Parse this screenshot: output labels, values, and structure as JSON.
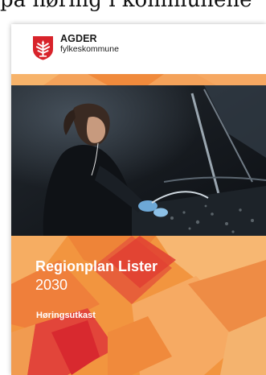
{
  "page_heading": "på høring i kommunene",
  "publisher": {
    "name": "AGDER",
    "subtitle": "fylkeskommune",
    "logo_icon": "coat-of-arms-icon"
  },
  "document": {
    "title": "Regionplan Lister",
    "year": "2030",
    "status": "Høringsutkast"
  },
  "colors": {
    "orange_light": "#f7b36a",
    "orange": "#f08a3c",
    "red_orange": "#e6553a",
    "red": "#d8292f",
    "photo_dark": "#14171c"
  }
}
